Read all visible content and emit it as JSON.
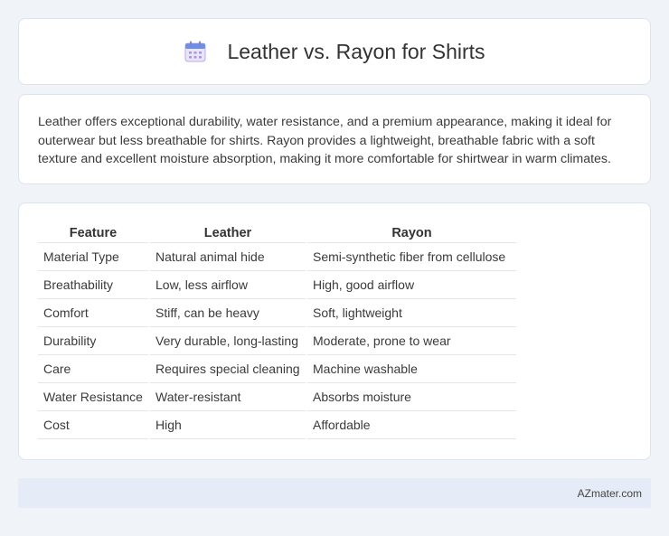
{
  "header": {
    "title": "Leather vs. Rayon for Shirts",
    "icon": "calendar-icon"
  },
  "description": "Leather offers exceptional durability, water resistance, and a premium appearance, making it ideal for outerwear but less breathable for shirts. Rayon provides a lightweight, breathable fabric with a soft texture and excellent moisture absorption, making it more comfortable for shirtwear in warm climates.",
  "table": {
    "headers": [
      "Feature",
      "Leather",
      "Rayon"
    ],
    "rows": [
      [
        "Material Type",
        "Natural animal hide",
        "Semi-synthetic fiber from cellulose"
      ],
      [
        "Breathability",
        "Low, less airflow",
        "High, good airflow"
      ],
      [
        "Comfort",
        "Stiff, can be heavy",
        "Soft, lightweight"
      ],
      [
        "Durability",
        "Very durable, long-lasting",
        "Moderate, prone to wear"
      ],
      [
        "Care",
        "Requires special cleaning",
        "Machine washable"
      ],
      [
        "Water Resistance",
        "Water-resistant",
        "Absorbs moisture"
      ],
      [
        "Cost",
        "High",
        "Affordable"
      ]
    ]
  },
  "footer": {
    "site": "AZmater.com"
  }
}
